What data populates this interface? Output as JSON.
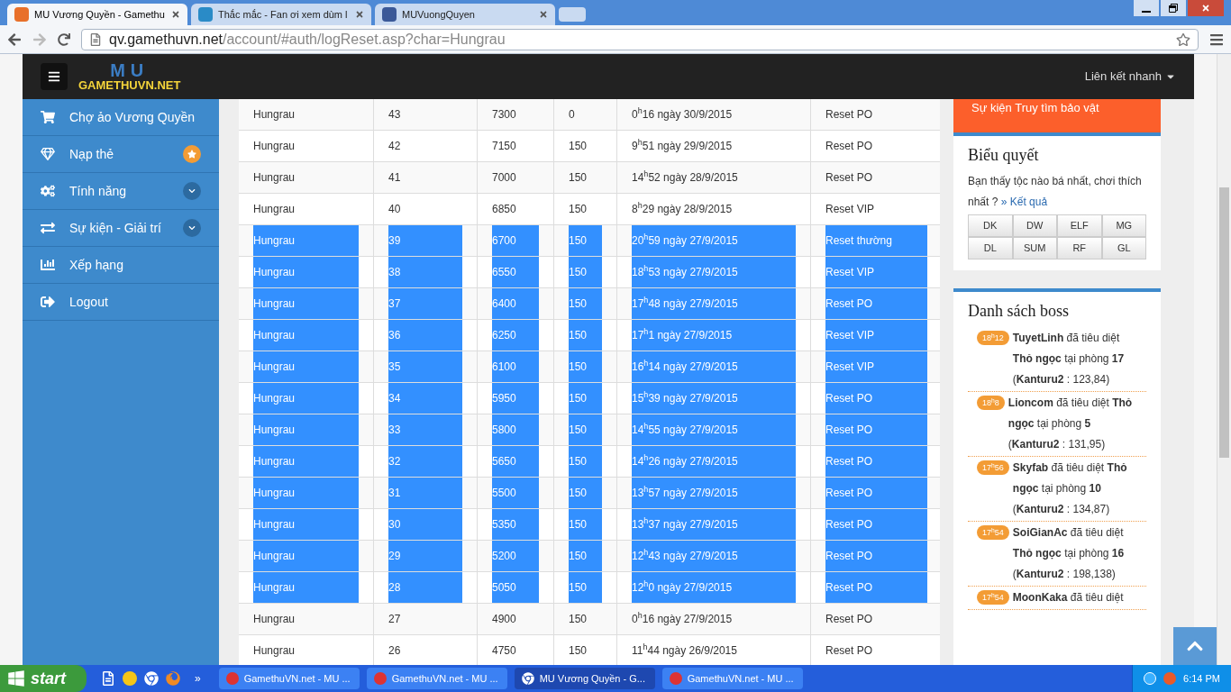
{
  "browser": {
    "tabs": [
      {
        "title": "MU Vương Quyền - Gamethu",
        "selected": true
      },
      {
        "title": "Thắc mắc - Fan ơi xem dùm l",
        "selected": false
      },
      {
        "title": "MUVuongQuyen",
        "selected": false
      }
    ],
    "url_host": "qv.gamethuvn.net",
    "url_path": "/account/#auth/logReset.asp?char=Hungrau"
  },
  "header": {
    "logo_big": "MU",
    "logo": "GAMETHUVN.NET",
    "quick_links": "Liên kết nhanh"
  },
  "sidebar": {
    "items": [
      {
        "label": "Chợ ảo Vương Quyền",
        "kind": "plain"
      },
      {
        "label": "Nạp thẻ",
        "kind": "starred"
      },
      {
        "label": "Tính năng",
        "kind": "submenu"
      },
      {
        "label": "Sự kiện - Giải trí",
        "kind": "submenu"
      },
      {
        "label": "Xếp hạng",
        "kind": "plain"
      },
      {
        "label": "Logout",
        "kind": "plain"
      }
    ]
  },
  "table": {
    "rows": [
      {
        "cells": [
          "Hungrau",
          "43",
          "7300",
          "0",
          "0$^{h}$16 ngày 30/9/2015",
          "Reset PO"
        ],
        "selected": false
      },
      {
        "cells": [
          "Hungrau",
          "42",
          "7150",
          "150",
          "9$^{h}$51 ngày 29/9/2015",
          "Reset PO"
        ],
        "selected": false
      },
      {
        "cells": [
          "Hungrau",
          "41",
          "7000",
          "150",
          "14$^{h}$52 ngày 28/9/2015",
          "Reset PO"
        ],
        "selected": false
      },
      {
        "cells": [
          "Hungrau",
          "40",
          "6850",
          "150",
          "8$^{h}$29 ngày 28/9/2015",
          "Reset VIP"
        ],
        "selected": false
      },
      {
        "cells": [
          "Hungrau",
          "39",
          "6700",
          "150",
          "20$^{h}$59 ngày 27/9/2015",
          "Reset thường"
        ],
        "selected": true
      },
      {
        "cells": [
          "Hungrau",
          "38",
          "6550",
          "150",
          "18$^{h}$53 ngày 27/9/2015",
          "Reset VIP"
        ],
        "selected": true
      },
      {
        "cells": [
          "Hungrau",
          "37",
          "6400",
          "150",
          "17$^{h}$48 ngày 27/9/2015",
          "Reset PO"
        ],
        "selected": true
      },
      {
        "cells": [
          "Hungrau",
          "36",
          "6250",
          "150",
          "17$^{h}$1 ngày 27/9/2015",
          "Reset VIP"
        ],
        "selected": true
      },
      {
        "cells": [
          "Hungrau",
          "35",
          "6100",
          "150",
          "16$^{h}$14 ngày 27/9/2015",
          "Reset VIP"
        ],
        "selected": true
      },
      {
        "cells": [
          "Hungrau",
          "34",
          "5950",
          "150",
          "15$^{h}$39 ngày 27/9/2015",
          "Reset PO"
        ],
        "selected": true
      },
      {
        "cells": [
          "Hungrau",
          "33",
          "5800",
          "150",
          "14$^{h}$55 ngày 27/9/2015",
          "Reset PO"
        ],
        "selected": true
      },
      {
        "cells": [
          "Hungrau",
          "32",
          "5650",
          "150",
          "14$^{h}$26 ngày 27/9/2015",
          "Reset PO"
        ],
        "selected": true
      },
      {
        "cells": [
          "Hungrau",
          "31",
          "5500",
          "150",
          "13$^{h}$57 ngày 27/9/2015",
          "Reset PO"
        ],
        "selected": true
      },
      {
        "cells": [
          "Hungrau",
          "30",
          "5350",
          "150",
          "13$^{h}$37 ngày 27/9/2015",
          "Reset PO"
        ],
        "selected": true
      },
      {
        "cells": [
          "Hungrau",
          "29",
          "5200",
          "150",
          "12$^{h}$43 ngày 27/9/2015",
          "Reset PO"
        ],
        "selected": true
      },
      {
        "cells": [
          "Hungrau",
          "28",
          "5050",
          "150",
          "12$^{h}$0 ngày 27/9/2015",
          "Reset PO"
        ],
        "selected": true
      },
      {
        "cells": [
          "Hungrau",
          "27",
          "4900",
          "150",
          "0$^{h}$16 ngày 27/9/2015",
          "Reset PO"
        ],
        "selected": false
      },
      {
        "cells": [
          "Hungrau",
          "26",
          "4750",
          "150",
          "11$^{h}$44 ngày 26/9/2015",
          "Reset PO"
        ],
        "selected": false
      }
    ]
  },
  "event_banner": "Sự kiện Truy tìm bảo vật",
  "poll": {
    "title": "Biểu quyết",
    "question": "Bạn thấy tộc nào bá nhất, chơi thích nhất ?",
    "result_link": "» Kết quả",
    "options": [
      "DK",
      "DW",
      "ELF",
      "MG",
      "DL",
      "SUM",
      "RF",
      "GL"
    ]
  },
  "bosses": {
    "title": "Danh sách boss",
    "items": [
      {
        "time": "18$^{h}$12",
        "text": "**TuyetLinh** đã tiêu diệt **Thỏ ngọc** tại phòng **17** (**Kanturu2** : 123,84)"
      },
      {
        "time": "18$^{h}$8",
        "text": "**Lioncom** đã tiêu diệt **Thỏ ngọc** tại phòng **5** (**Kanturu2** : 131,95)"
      },
      {
        "time": "17$^{h}$56",
        "text": "**Skyfab** đã tiêu diệt **Thỏ ngọc** tại phòng **10** (**Kanturu2** : 134,87)"
      },
      {
        "time": "17$^{h}$54",
        "text": "**SoiGianAc** đã tiêu diệt **Thỏ ngọc** tại phòng **16** (**Kanturu2** : 198,138)"
      },
      {
        "time": "17$^{h}$54",
        "text": "**MoonKaka** đã tiêu diệt"
      }
    ]
  },
  "taskbar": {
    "start": "start",
    "tasks": [
      {
        "title": "GamethuVN.net - MU ...",
        "selected": false
      },
      {
        "title": "GamethuVN.net - MU ...",
        "selected": false
      },
      {
        "title": "MU Vương Quyền - G...",
        "selected": true
      },
      {
        "title": "GamethuVN.net - MU ...",
        "selected": false
      }
    ],
    "overflow": "»",
    "clock": "6:14 PM"
  }
}
